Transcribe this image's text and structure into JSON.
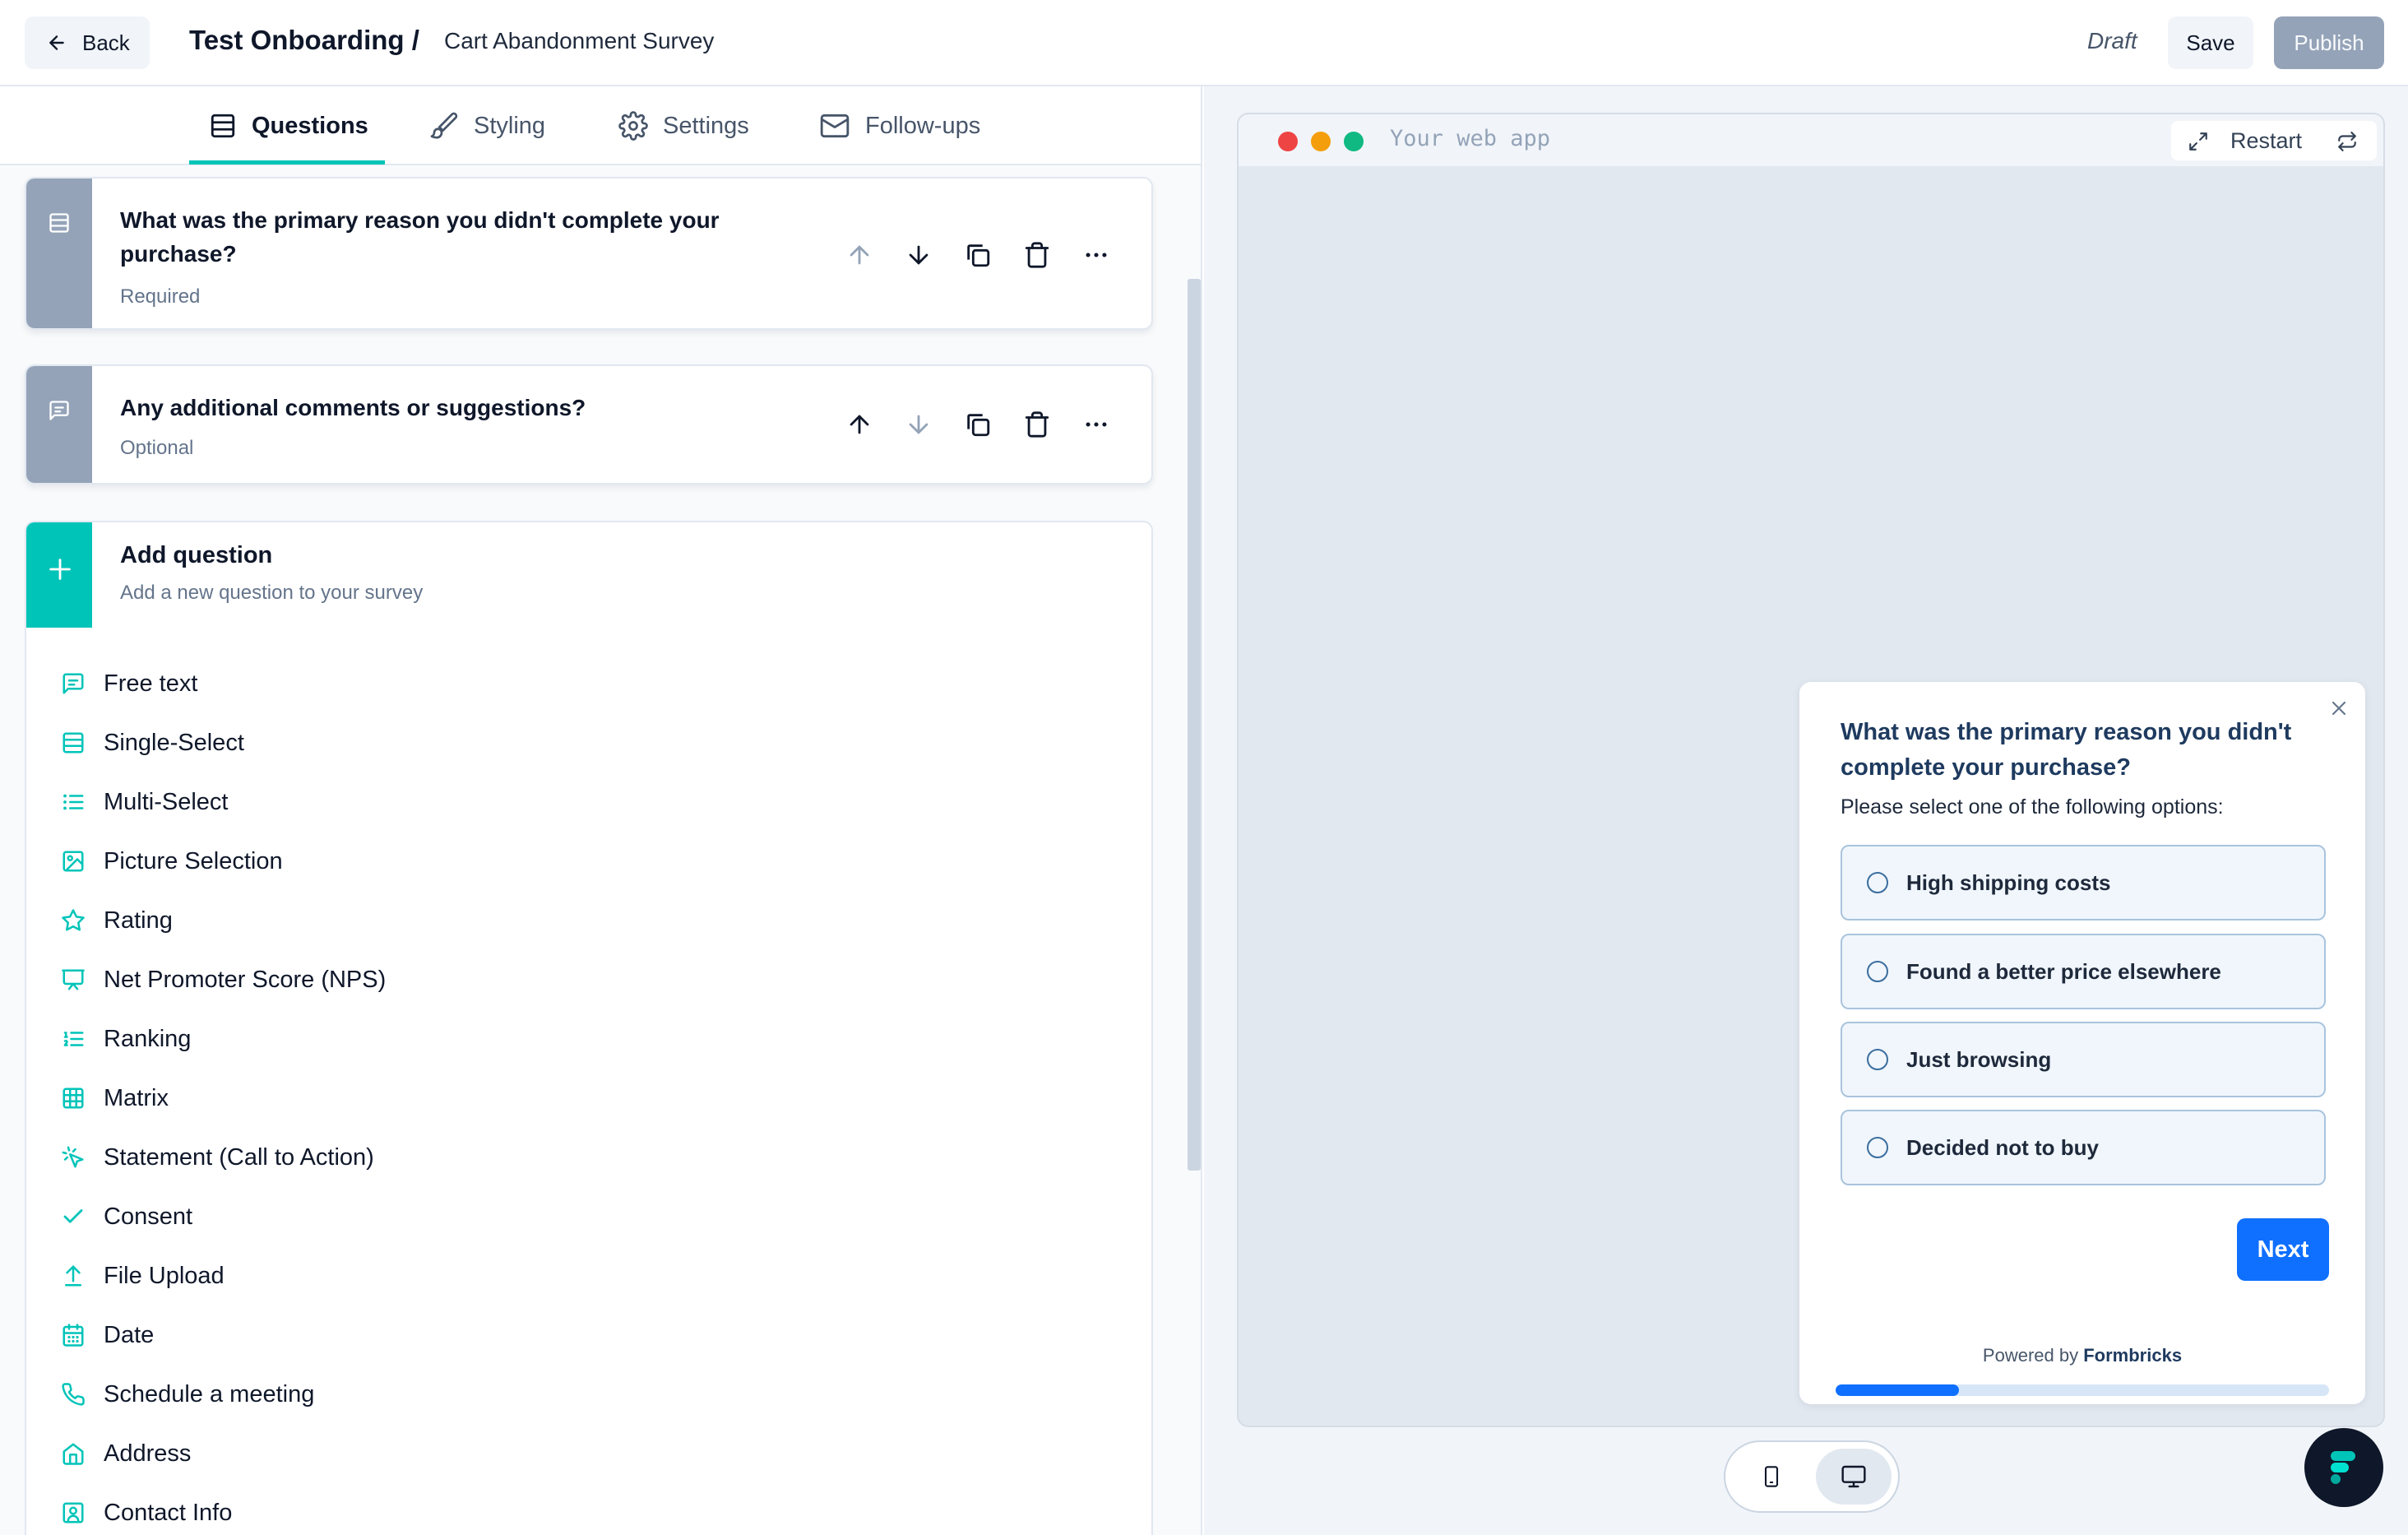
{
  "header": {
    "back_label": "Back",
    "survey_folder": "Test Onboarding /",
    "survey_name": "Cart Abandonment Survey",
    "status": "Draft",
    "save_label": "Save",
    "publish_label": "Publish"
  },
  "tabs": [
    {
      "label": "Questions",
      "icon": "rows-icon",
      "active": true
    },
    {
      "label": "Styling",
      "icon": "paintbrush-icon"
    },
    {
      "label": "Settings",
      "icon": "gear-icon"
    },
    {
      "label": "Follow-ups",
      "icon": "mail-icon"
    }
  ],
  "questions": [
    {
      "title": "What was the primary reason you didn't complete your purchase?",
      "status": "Required",
      "type_icon": "rows-icon"
    },
    {
      "title": "Any additional comments or suggestions?",
      "status": "Optional",
      "type_icon": "message-icon"
    }
  ],
  "add_question": {
    "title": "Add question",
    "subtitle": "Add a new question to your survey",
    "types": [
      {
        "label": "Free text",
        "icon": "message-icon"
      },
      {
        "label": "Single-Select",
        "icon": "rows-icon"
      },
      {
        "label": "Multi-Select",
        "icon": "list-icon"
      },
      {
        "label": "Picture Selection",
        "icon": "image-icon"
      },
      {
        "label": "Rating",
        "icon": "star-icon"
      },
      {
        "label": "Net Promoter Score (NPS)",
        "icon": "presentation-icon"
      },
      {
        "label": "Ranking",
        "icon": "ordered-list-icon"
      },
      {
        "label": "Matrix",
        "icon": "grid-icon"
      },
      {
        "label": "Statement (Call to Action)",
        "icon": "pointer-click-icon"
      },
      {
        "label": "Consent",
        "icon": "check-icon"
      },
      {
        "label": "File Upload",
        "icon": "upload-icon"
      },
      {
        "label": "Date",
        "icon": "calendar-icon"
      },
      {
        "label": "Schedule a meeting",
        "icon": "phone-icon"
      },
      {
        "label": "Address",
        "icon": "home-icon"
      },
      {
        "label": "Contact Info",
        "icon": "contact-icon"
      }
    ]
  },
  "preview": {
    "url_placeholder": "Your web app",
    "restart_label": "Restart",
    "survey": {
      "question": "What was the primary reason you didn't complete your purchase?",
      "subheader": "Please select one of the following options:",
      "options": [
        "High shipping costs",
        "Found a better price elsewhere",
        "Just browsing",
        "Decided not to buy"
      ],
      "next_label": "Next",
      "powered_by_prefix": "Powered by",
      "powered_by_brand": "Formbricks",
      "progress": 0.25
    },
    "device_modes": [
      "mobile",
      "desktop"
    ],
    "active_device": "desktop"
  },
  "colors": {
    "accent": "#00c4b8",
    "primary_blue": "#0f6fff",
    "slate_side": "#94a3b8",
    "publish_disabled": "#94a3b8",
    "window_red": "#ef4444",
    "window_yellow": "#f59e0b",
    "window_green": "#10b981"
  }
}
